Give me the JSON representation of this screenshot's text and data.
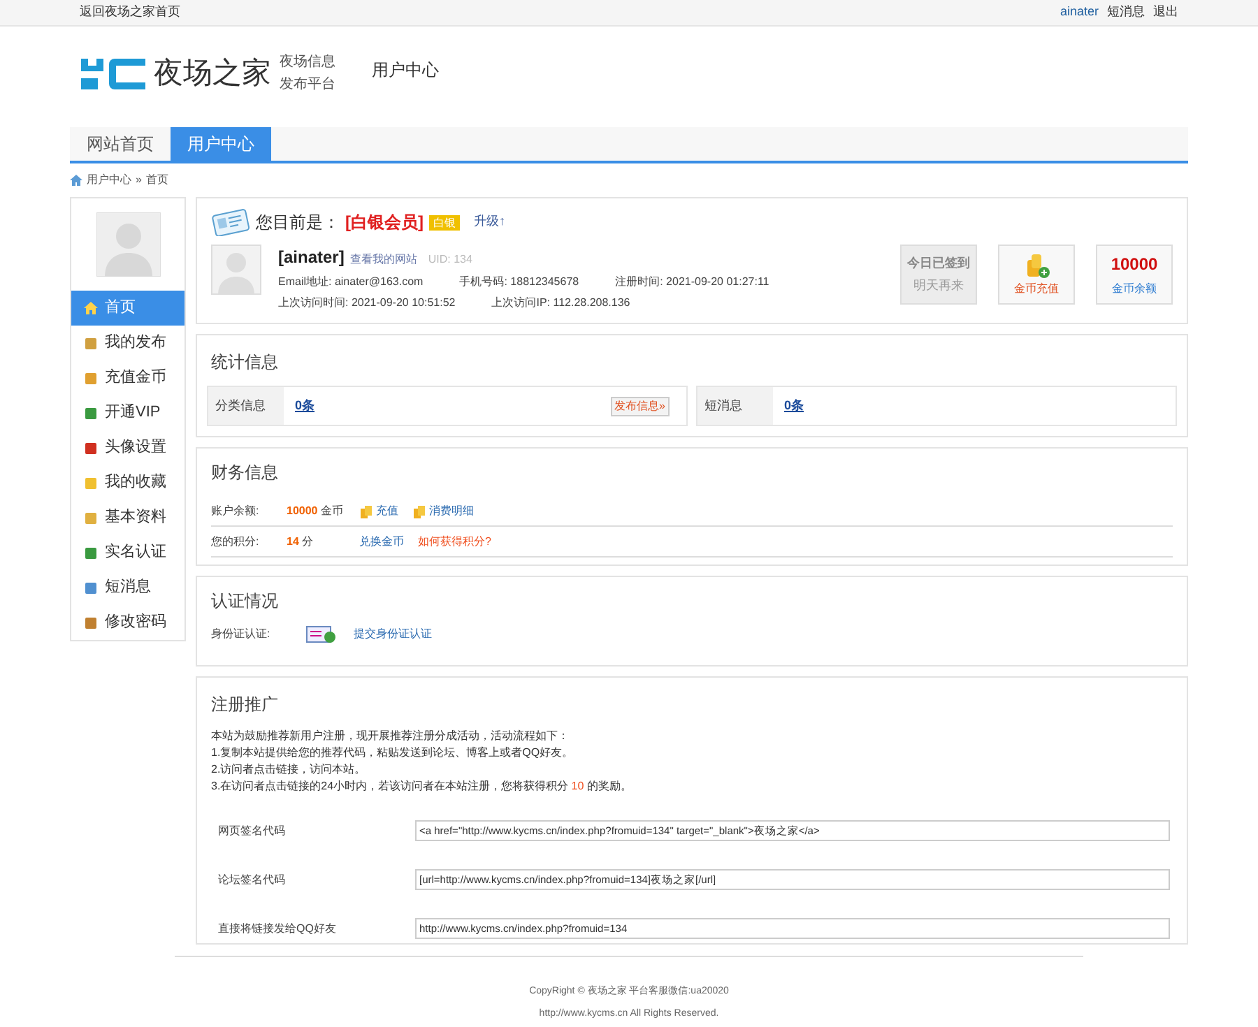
{
  "top_bar": {
    "home_link": "返回夜场之家首页",
    "user": "ainater",
    "links": [
      "短消息",
      "退出"
    ]
  },
  "header": {
    "logo_text": "夜场之家",
    "tagline": [
      "夜场信息",
      "发布平台"
    ],
    "section": "用户中心"
  },
  "nav": [
    {
      "label": "网站首页",
      "selected": false
    },
    {
      "label": "用户中心",
      "selected": true
    }
  ],
  "breadcrumb": [
    "用户中心",
    "»",
    "首页"
  ],
  "sidebar": [
    {
      "label": "首页",
      "selected": true
    },
    {
      "label": "我的发布",
      "selected": false
    },
    {
      "label": "充值金币",
      "selected": false
    },
    {
      "label": "开通VIP",
      "selected": false
    },
    {
      "label": "头像设置",
      "selected": false
    },
    {
      "label": "我的收藏",
      "selected": false
    },
    {
      "label": "基本资料",
      "selected": false
    },
    {
      "label": "实名认证",
      "selected": false
    },
    {
      "label": "短消息",
      "selected": false
    },
    {
      "label": "修改密码",
      "selected": false
    }
  ],
  "member": {
    "prefix": "您目前是：",
    "level": "[白银会员]",
    "badge": "白银",
    "upgrade": "升级↑",
    "username": "[ainater]",
    "site_link": "查看我的网站",
    "uid": "UID: 134",
    "details": [
      "Email地址: ainater@163.com",
      "手机号码: 18812345678",
      "注册时间: 2021-09-20 01:27:11",
      "上次访问时间: 2021-09-20 10:51:52",
      "上次访问IP: 112.28.208.136"
    ],
    "checkin": {
      "title": "今日已签到",
      "subtitle": "明天再来"
    },
    "recharge": "金币充值",
    "balance": {
      "value": "10000",
      "label": "金币余额"
    }
  },
  "stats": {
    "title": "统计信息",
    "cells": [
      {
        "label": "分类信息",
        "value": "0条",
        "button": "发布信息»"
      },
      {
        "label": "短消息",
        "value": "0条"
      }
    ]
  },
  "finance": {
    "title": "财务信息",
    "rows": [
      {
        "label": "账户余额:",
        "value": "10000",
        "unit": "金币",
        "links": [
          "充值",
          "消费明细"
        ]
      },
      {
        "label": "您的积分:",
        "value": "14",
        "unit": "分",
        "links": [
          "兑换金币",
          "如何获得积分?"
        ]
      }
    ]
  },
  "verification": {
    "title": "认证情况",
    "label": "身份证认证:",
    "link": "提交身份证认证"
  },
  "promotion": {
    "title": "注册推广",
    "intro": [
      "本站为鼓励推荐新用户注册，现开展推荐注册分成活动，活动流程如下：",
      "1.复制本站提供给您的推荐代码，粘贴发送到论坛、博客上或者QQ好友。",
      "2.访问者点击链接，访问本站。",
      "3.在访问者点击链接的24小时内，若该访问者在本站注册，您将获得积分 **10** 的奖励。"
    ],
    "codes": [
      {
        "label": "网页签名代码",
        "value": "<a href=\"http://www.kycms.cn/index.php?fromuid=134\" target=\"_blank\">夜场之家</a>"
      },
      {
        "label": "论坛签名代码",
        "value": "[url=http://www.kycms.cn/index.php?fromuid=134]夜场之家[/url]"
      },
      {
        "label": "直接将链接发给QQ好友",
        "value": "http://www.kycms.cn/index.php?fromuid=134"
      }
    ]
  },
  "footer": [
    "CopyRight © 夜场之家 平台客服微信:ua20020",
    "http://www.kycms.cn All Rights Reserved."
  ]
}
